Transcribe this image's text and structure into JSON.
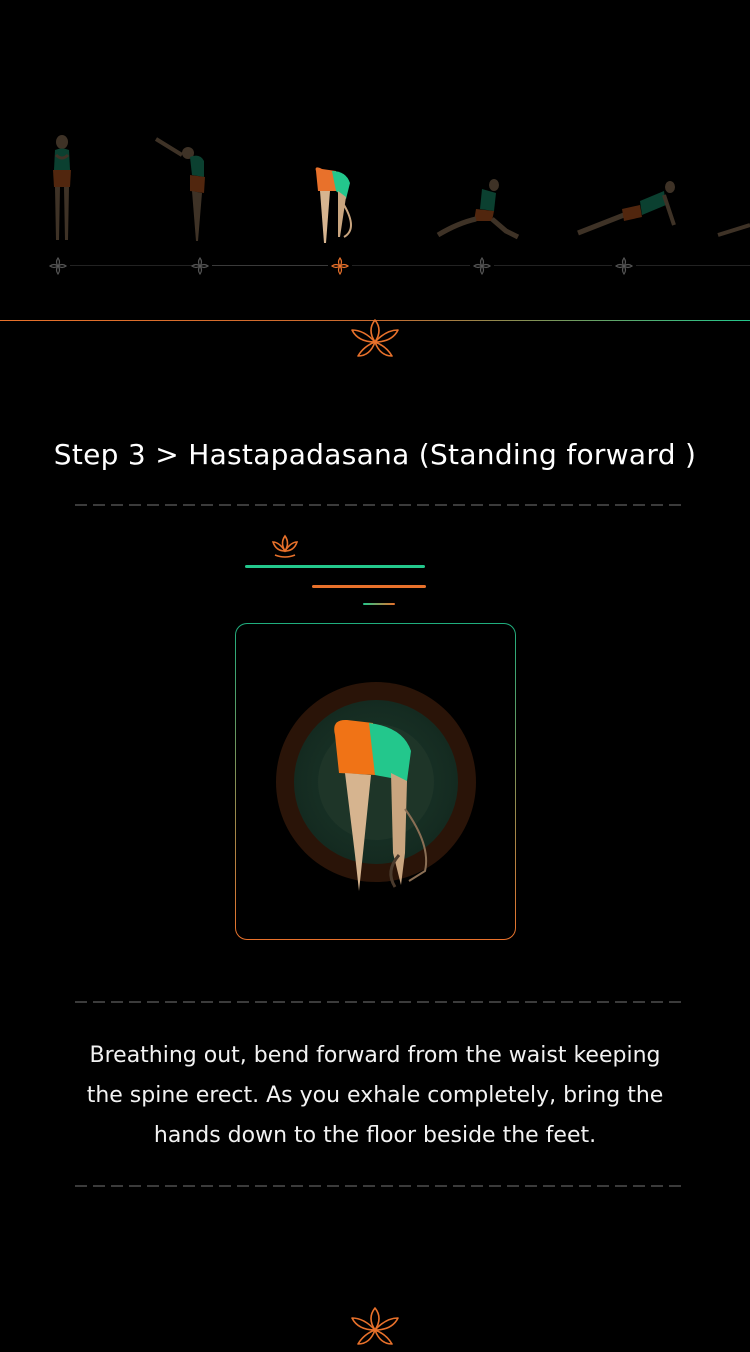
{
  "carousel": {
    "poses": [
      {
        "name": "pranamasana",
        "state": "inactive"
      },
      {
        "name": "hasta-uttanasana",
        "state": "inactive"
      },
      {
        "name": "hastapadasana",
        "state": "active"
      },
      {
        "name": "ashwa-sanchalanasana",
        "state": "inactive"
      },
      {
        "name": "dandasana",
        "state": "inactive"
      },
      {
        "name": "next-pose",
        "state": "inactive"
      }
    ]
  },
  "step": {
    "title": "Step 3 > Hastapadasana (Standing forward )"
  },
  "description": "Breathing out, bend forward from the waist keeping the spine erect. As you exhale completely, bring the hands down to the floor beside the feet.",
  "colors": {
    "accent_orange": "#e8712b",
    "accent_green": "#23c78c",
    "skin": "#d6b48f",
    "background": "#000000"
  },
  "icons": {
    "lotus": "lotus-icon",
    "marker": "flower-marker-icon"
  }
}
